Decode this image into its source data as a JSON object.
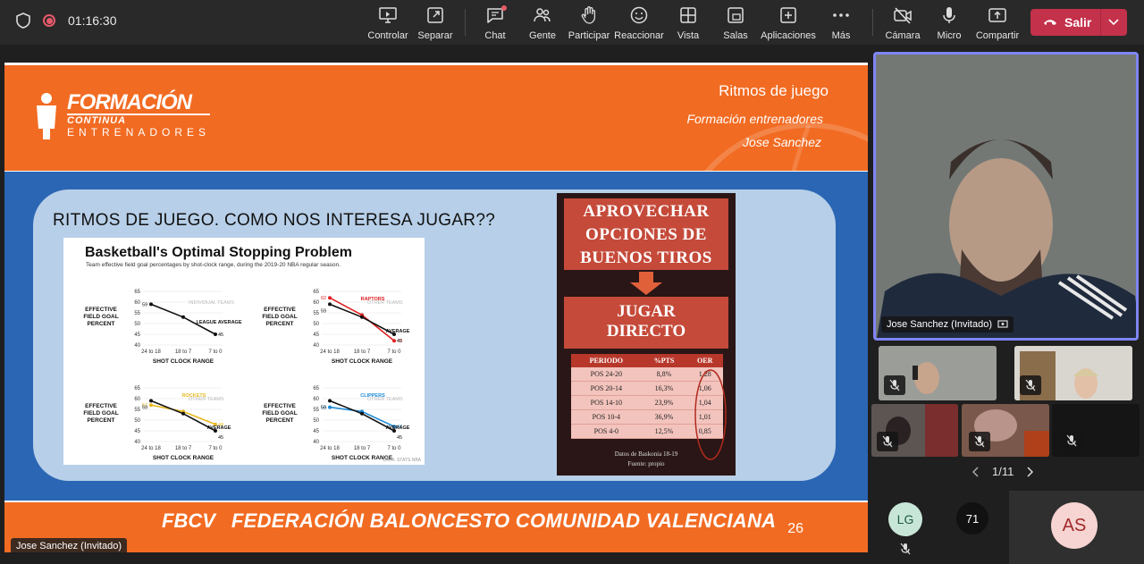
{
  "topbar": {
    "timer": "01:16:30",
    "tools": [
      {
        "label": "Controlar",
        "icon": "monitor-control-icon"
      },
      {
        "label": "Separar",
        "icon": "pop-out-icon"
      },
      {
        "label": "Chat",
        "icon": "chat-icon"
      },
      {
        "label": "Gente",
        "icon": "people-icon"
      },
      {
        "label": "Participar",
        "icon": "raise-hand-icon"
      },
      {
        "label": "Reaccionar",
        "icon": "smile-icon"
      },
      {
        "label": "Vista",
        "icon": "grid-view-icon"
      },
      {
        "label": "Salas",
        "icon": "rooms-icon"
      },
      {
        "label": "Aplicaciones",
        "icon": "plus-icon"
      },
      {
        "label": "Más",
        "icon": "more-icon"
      },
      {
        "label": "Cámara",
        "icon": "camera-off-icon"
      },
      {
        "label": "Micro",
        "icon": "microphone-icon"
      },
      {
        "label": "Compartir",
        "icon": "share-icon"
      }
    ],
    "leave_label": "Salir"
  },
  "slide": {
    "logo_line1": "FORMACIÓN",
    "logo_line2": "CONTINUA",
    "logo_line3": "ENTRENADORES",
    "title": "Ritmos de juego",
    "subtitle1": "Formación entrenadores",
    "subtitle2": "Jose Sanchez",
    "panel_title": "RITMOS DE JUEGO. COMO NOS INTERESA JUGAR??",
    "chart_title": "Basketball's Optimal Stopping Problem",
    "chart_subtitle": "Team effective field goal percentages by shot-clock range, during the 2019-20 NBA regular season.",
    "chart_source": "DATA: STATS.NBA",
    "card_heading1": [
      "APROVECHAR",
      "OPCIONES DE",
      "BUENOS TIROS"
    ],
    "card_heading2": [
      "JUGAR",
      "DIRECTO"
    ],
    "table_headers": [
      "PERIODO",
      "%PTS",
      "OER"
    ],
    "table_rows": [
      [
        "POS 24-20",
        "8,8%",
        "1,28"
      ],
      [
        "POS 20-14",
        "16,3%",
        "1,06"
      ],
      [
        "POS 14-10",
        "23,9%",
        "1,04"
      ],
      [
        "POS 10-4",
        "36,9%",
        "1,01"
      ],
      [
        "POS 4-0",
        "12,5%",
        "0,85"
      ]
    ],
    "credit1": "Datos de Baskonia 18-19",
    "credit2": "Fuente: propio",
    "footer_logo": "FBCV",
    "footer_name": "FEDERACIÓN BALONCESTO COMUNIDAD VALENCIANA",
    "page_number": "26",
    "owner_label": "Jose Sanchez (Invitado)"
  },
  "chart_data": [
    {
      "type": "line",
      "title": "",
      "ylabel": "EFFECTIVE FIELD GOAL PERCENT",
      "xlabel": "SHOT CLOCK RANGE",
      "categories": [
        "24 to 18",
        "18 to 7",
        "7 to 0"
      ],
      "ylim": [
        40,
        65
      ],
      "series": [
        {
          "name": "LEAGUE AVERAGE",
          "values": [
            59,
            53,
            45
          ]
        }
      ],
      "annotations": [
        "INDIVIDUAL TEAMS"
      ]
    },
    {
      "type": "line",
      "title": "",
      "ylabel": "EFFECTIVE FIELD GOAL PERCENT",
      "xlabel": "SHOT CLOCK RANGE",
      "categories": [
        "24 to 18",
        "18 to 7",
        "7 to 0"
      ],
      "ylim": [
        40,
        65
      ],
      "series": [
        {
          "name": "RAPTORS",
          "values": [
            62,
            54,
            42
          ]
        },
        {
          "name": "AVERAGE",
          "values": [
            59,
            53,
            45
          ]
        }
      ],
      "annotations": [
        "OTHER TEAMS"
      ]
    },
    {
      "type": "line",
      "title": "",
      "ylabel": "EFFECTIVE FIELD GOAL PERCENT",
      "xlabel": "SHOT CLOCK RANGE",
      "categories": [
        "24 to 18",
        "18 to 7",
        "7 to 0"
      ],
      "ylim": [
        40,
        65
      ],
      "series": [
        {
          "name": "ROCKETS",
          "values": [
            57,
            54,
            48
          ]
        },
        {
          "name": "AVERAGE",
          "values": [
            59,
            53,
            45
          ]
        }
      ],
      "annotations": [
        "OTHER TEAMS"
      ]
    },
    {
      "type": "line",
      "title": "",
      "ylabel": "EFFECTIVE FIELD GOAL PERCENT",
      "xlabel": "SHOT CLOCK RANGE",
      "categories": [
        "24 to 18",
        "18 to 7",
        "7 to 0"
      ],
      "ylim": [
        40,
        65
      ],
      "series": [
        {
          "name": "CLIPPERS",
          "values": [
            56,
            54,
            47
          ]
        },
        {
          "name": "AVERAGE",
          "values": [
            59,
            53,
            45
          ]
        }
      ],
      "annotations": [
        "OTHER TEAMS"
      ]
    }
  ],
  "participants": {
    "main_name": "Jose Sanchez (Invitado)",
    "pager": "1/11",
    "avatars": [
      {
        "initials": "LG",
        "color": "#c8e6d8",
        "text_color": "#1e5a3e"
      },
      {
        "initials": "71",
        "color": "#111111",
        "text_color": "#ffffff"
      },
      {
        "initials": "AS",
        "color": "#f6d4d2",
        "text_color": "#a02a2a"
      }
    ]
  }
}
